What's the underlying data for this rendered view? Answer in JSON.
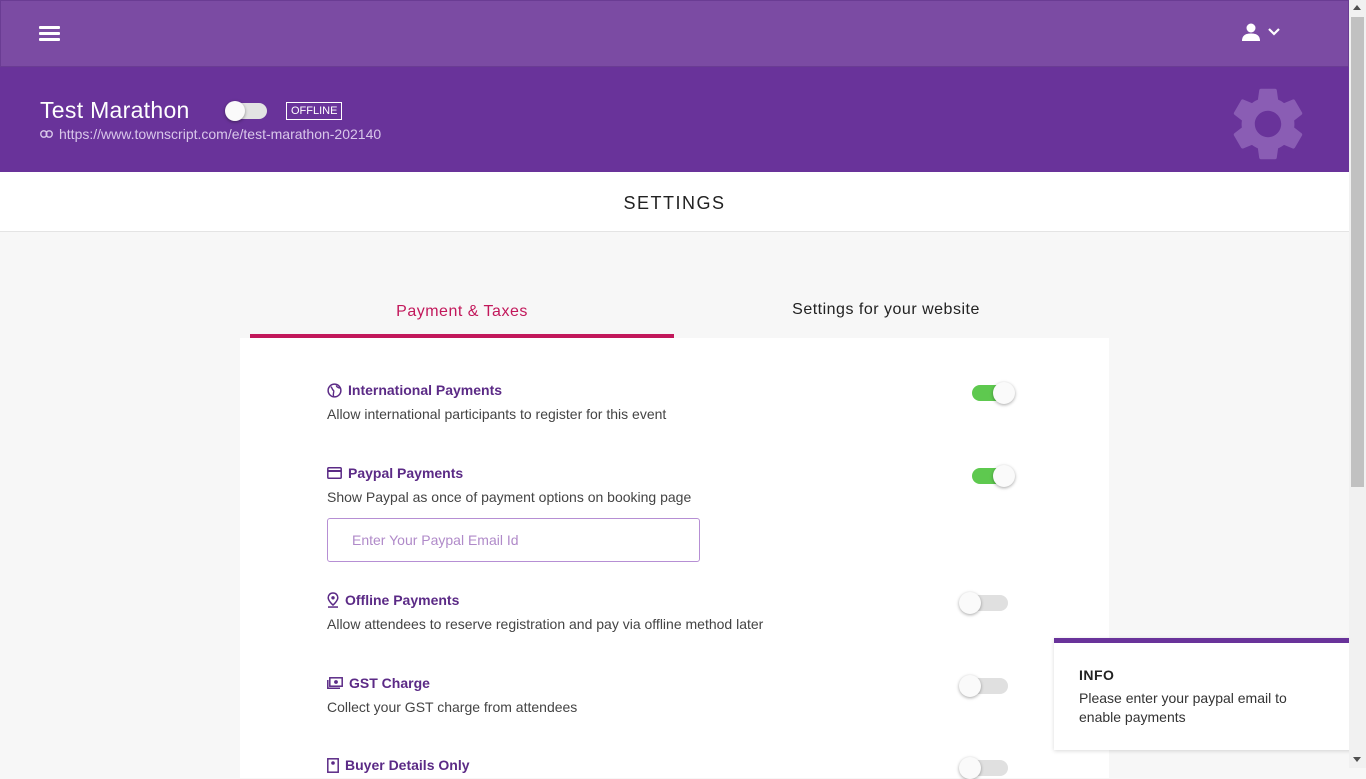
{
  "header": {
    "menu_icon": "hamburger-icon",
    "user_icon": "user-icon",
    "dropdown_icon": "chevron-down-icon"
  },
  "event": {
    "title": "Test Marathon",
    "status_badge": "OFFLINE",
    "live_toggle_on": false,
    "url": "https://www.townscript.com/e/test-marathon-202140",
    "link_icon": "link-icon",
    "gear_icon": "gear-icon"
  },
  "page": {
    "title": "SETTINGS"
  },
  "tabs": [
    {
      "label": "Payment & Taxes",
      "active": true
    },
    {
      "label": "Settings for your website",
      "active": false
    }
  ],
  "settings": [
    {
      "icon": "globe-icon",
      "title": "International Payments",
      "description": "Allow international participants to register for this event",
      "enabled": true
    },
    {
      "icon": "credit-card-icon",
      "title": "Paypal Payments",
      "description": "Show Paypal as once of payment options on booking page",
      "enabled": true
    },
    {
      "icon": "location-pin-icon",
      "title": "Offline Payments",
      "description": "Allow attendees to reserve registration and pay via offline method later",
      "enabled": false
    },
    {
      "icon": "cash-icon",
      "title": "GST Charge",
      "description": "Collect your GST charge from attendees",
      "enabled": false
    },
    {
      "icon": "contact-icon",
      "title": "Buyer Details Only",
      "enabled": false
    }
  ],
  "paypal_input": {
    "placeholder": "Enter Your Paypal Email Id",
    "value": ""
  },
  "info": {
    "title": "INFO",
    "message": "Please enter your paypal email to enable payments"
  },
  "colors": {
    "topbar": "#7b4ba3",
    "hero": "#69339a",
    "accent": "#c2185b",
    "toggle_on": "#5ec94f",
    "setting_title": "#5b2a86"
  }
}
